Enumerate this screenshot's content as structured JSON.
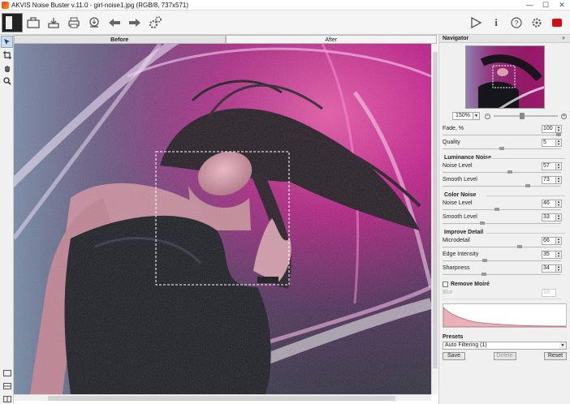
{
  "window": {
    "title": "AKVIS Noise Buster v.11.0 - girl-noise1.jpg (RGB/8, 737x571)"
  },
  "window_controls": {
    "minimize": "—",
    "maximize": "☐",
    "close": "✕"
  },
  "toolbar": {
    "left_icons": [
      "image-thumbnail-icon",
      "open-icon",
      "save-icon",
      "print-icon",
      "share-icon",
      "undo-icon",
      "redo-icon",
      "settings-gear-icon"
    ],
    "right_icons": [
      "run-icon",
      "info-icon",
      "help-icon",
      "preferences-icon",
      "record-icon"
    ]
  },
  "tools": [
    "navigator-tool-icon",
    "crop-icon",
    "hand-icon",
    "zoom-icon"
  ],
  "tabs": {
    "before": "Before",
    "after": "After"
  },
  "panel": {
    "navigator_title": "Navigator",
    "zoom": "150%",
    "fade_label": "Fade, %",
    "fade_value": "100",
    "quality_label": "Quality",
    "quality_value": "5",
    "luminance_title": "Luminance Noise",
    "lum_noise_label": "Noise Level",
    "lum_noise_value": "57",
    "lum_smooth_label": "Smooth Level",
    "lum_smooth_value": "73",
    "color_title": "Color Noise",
    "col_noise_label": "Noise Level",
    "col_noise_value": "46",
    "col_smooth_label": "Smooth Level",
    "col_smooth_value": "33",
    "improve_title": "Improve Detail",
    "microdetail_label": "Microdetail",
    "microdetail_value": "66",
    "edge_label": "Edge Intensity",
    "edge_value": "35",
    "sharpness_label": "Sharpness",
    "sharpness_value": "34",
    "moire_label": "Remove Moiré",
    "blur_label": "Blur",
    "blur_value": "10",
    "presets_label": "Presets",
    "preset_selected": "Auto Filtering (1)",
    "save_btn": "Save",
    "delete_btn": "Delete",
    "reset_btn": "Reset"
  },
  "sliders": {
    "fade": 1.0,
    "quality": 0.5,
    "lum_noise": 0.57,
    "lum_smooth": 0.73,
    "col_noise": 0.46,
    "col_smooth": 0.33,
    "microdetail": 0.66,
    "edge": 0.35,
    "sharpness": 0.34,
    "zoom": 0.4
  },
  "colors": {
    "accent": "#c8dcef",
    "record": "#d01010",
    "photo_magenta": "#d0208a"
  }
}
